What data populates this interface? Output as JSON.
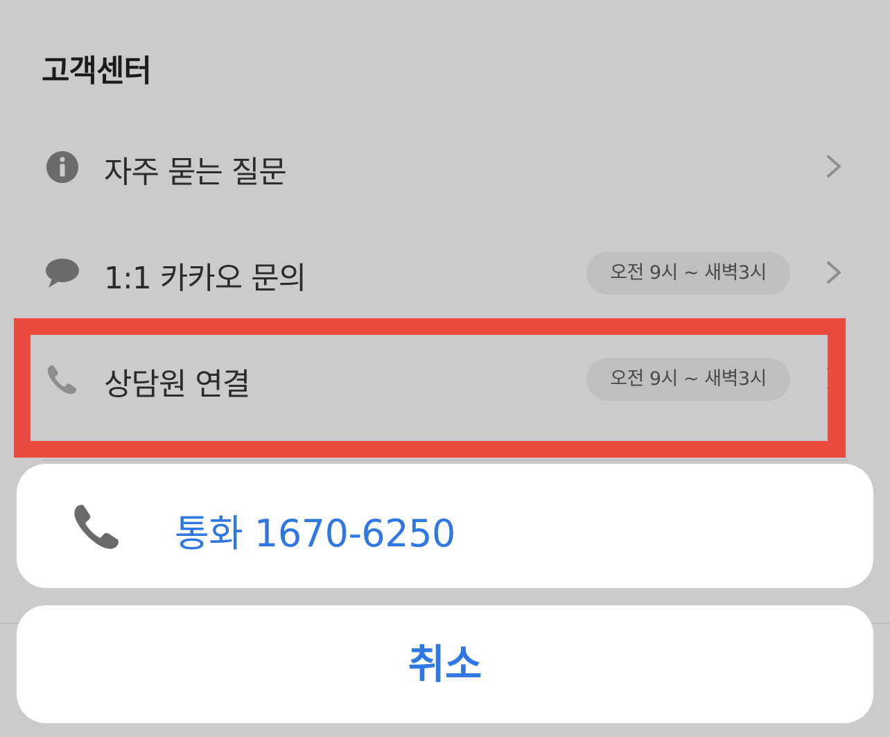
{
  "section": {
    "title": "고객센터"
  },
  "menu": {
    "items": [
      {
        "label": "자주 묻는 질문",
        "icon": "info-icon",
        "hours": null
      },
      {
        "label": "1:1 카카오 문의",
        "icon": "chat-bubble-icon",
        "hours": "오전 9시 ~ 새벽3시"
      },
      {
        "label": "상담원 연결",
        "icon": "phone-icon",
        "hours": "오전 9시 ~ 새벽3시"
      }
    ]
  },
  "action_sheet": {
    "call_label": "통화 1670-6250",
    "cancel_label": "취소"
  },
  "colors": {
    "background": "#cbcbcb",
    "accent_blue": "#2f78e3",
    "highlight_red": "#e94c3e",
    "pill_background": "#bfbfbf"
  }
}
